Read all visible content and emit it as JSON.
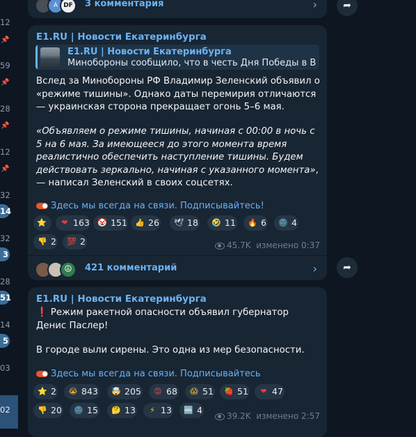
{
  "left_column": {
    "items": [
      {
        "value": "12"
      },
      {
        "value": "59"
      },
      {
        "value": "28"
      },
      {
        "value": "12"
      },
      {
        "value": "32"
      },
      {
        "value": "14"
      },
      {
        "value": "32"
      },
      {
        "value": "3"
      },
      {
        "value": "28"
      },
      {
        "value": "51"
      },
      {
        "value": "14"
      },
      {
        "value": "5"
      },
      {
        "value": "03"
      },
      {
        "value": "02"
      }
    ]
  },
  "top_comments": {
    "label": "3 комментария",
    "avatar_labels": [
      "A",
      "DF"
    ]
  },
  "post1": {
    "channel": "E1.RU | Новости Екатеринбурга",
    "reply": {
      "title": "E1.RU | Новости Екатеринбурга",
      "text": "Минобороны сообщило, что в честь Дня Победы в Вел…"
    },
    "paragraph1": "Вслед за Минобороны РФ Владимир Зеленский объявил о «режиме тишины». Однако даты перемирия отличаются — украинская сторона прекращает огонь 5–6 мая.",
    "quote": "«Объявляем о режиме тишины, начиная с 00:00 в ночь с 5 на 6 мая. За имеющееся до этого момента время реалистично обеспечить наступление тишины. Будем действовать зеркально, начиная с указанного момента»",
    "quote_tail": ", — написал Зеленский в своих соцсетях.",
    "promo": "Здесь мы всегда на связи. Подписывайтесь!",
    "reactions": [
      {
        "emoji": "⭐",
        "count": "",
        "color": "#f5b400"
      },
      {
        "emoji": "❤",
        "count": "163",
        "color": "#e5393b"
      },
      {
        "emoji": "🤡",
        "count": "151",
        "color": "#f0e0d0"
      },
      {
        "emoji": "👍",
        "count": "26",
        "color": "#f2c14e"
      },
      {
        "emoji": "🕊",
        "count": "18",
        "color": "#dfe6ea"
      },
      {
        "emoji": "🤣",
        "count": "11",
        "color": "#f6b93b"
      },
      {
        "emoji": "🔥",
        "count": "6",
        "color": "#f36c21"
      },
      {
        "emoji": "🌚",
        "count": "4",
        "color": "#5b6470"
      },
      {
        "emoji": "👎",
        "count": "2",
        "color": "#f2c14e"
      },
      {
        "emoji": "💯",
        "count": "2",
        "color": "#e5393b"
      }
    ],
    "views": "45.7K",
    "edited": "изменено 0:37",
    "comments": "421 комментарий"
  },
  "post2": {
    "channel": "E1.RU | Новости Екатеринбурга",
    "alert_icon": "❗",
    "paragraph1": "Режим ракетной опасности объявил губернатор Денис Паслер!",
    "paragraph2": "В городе выли сирены. Это одна из мер безопасности.",
    "promo": "Здесь мы всегда на связи. Подписывайтесь",
    "reactions": [
      {
        "emoji": "⭐",
        "count": "2",
        "color": "#f5b400"
      },
      {
        "emoji": "😭",
        "count": "843",
        "color": "#f6b93b"
      },
      {
        "emoji": "🤯",
        "count": "205",
        "color": "#f6b93b"
      },
      {
        "emoji": "😡",
        "count": "68",
        "color": "#e55039"
      },
      {
        "emoji": "😱",
        "count": "51",
        "color": "#f6b93b"
      },
      {
        "emoji": "🍓",
        "count": "51",
        "color": "#e5393b"
      },
      {
        "emoji": "❤",
        "count": "47",
        "color": "#e5393b"
      },
      {
        "emoji": "👎",
        "count": "20",
        "color": "#f2c14e"
      },
      {
        "emoji": "🌚",
        "count": "15",
        "color": "#5b6470"
      },
      {
        "emoji": "🤔",
        "count": "13",
        "color": "#f6b93b"
      },
      {
        "emoji": "⚡",
        "count": "13",
        "color": "#f5d000"
      },
      {
        "emoji": "🆒",
        "count": "4",
        "color": "#4a90d9"
      }
    ],
    "views": "39.2K",
    "edited": "изменено 2:57"
  },
  "colors": {
    "background": "#0e1621",
    "bubble": "#182533",
    "accent": "#6ab3f3",
    "selected": "#2b5278"
  }
}
